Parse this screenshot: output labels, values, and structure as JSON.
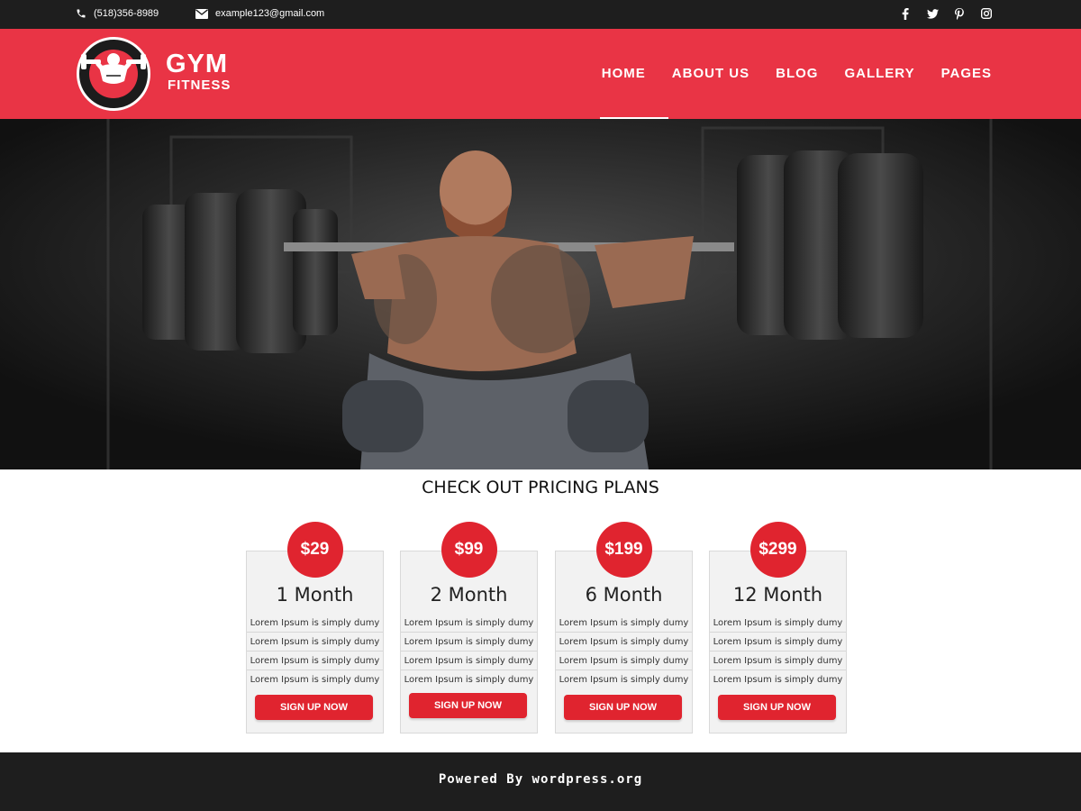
{
  "topbar": {
    "phone": "(518)356-8989",
    "email": "example123@gmail.com",
    "social": [
      "facebook-icon",
      "twitter-icon",
      "pinterest-icon",
      "instagram-icon"
    ]
  },
  "header": {
    "logo_title": "GYM",
    "logo_subtitle": "FITNESS",
    "nav": [
      "HOME",
      "ABOUT US",
      "BLOG",
      "GALLERY",
      "PAGES"
    ],
    "active_nav": "HOME"
  },
  "pricing": {
    "title": "CHECK OUT PRICING PLANS",
    "plans": [
      {
        "price": "$29",
        "duration": "1 Month",
        "features": [
          "Lorem Ipsum is simply dumy",
          "Lorem Ipsum is simply dumy",
          "Lorem Ipsum is simply dumy",
          "Lorem Ipsum is simply dumy"
        ],
        "button": "SIGN UP NOW"
      },
      {
        "price": "$99",
        "duration": "2 Month",
        "features": [
          "Lorem Ipsum is simply dumy",
          "Lorem Ipsum is simply dumy",
          "Lorem Ipsum is simply dumy",
          "Lorem Ipsum is simply dumy"
        ],
        "button": "SIGN UP NOW"
      },
      {
        "price": "$199",
        "duration": "6 Month",
        "features": [
          "Lorem Ipsum is simply dumy",
          "Lorem Ipsum is simply dumy",
          "Lorem Ipsum is simply dumy",
          "Lorem Ipsum is simply dumy"
        ],
        "button": "SIGN UP NOW"
      },
      {
        "price": "$299",
        "duration": "12 Month",
        "features": [
          "Lorem Ipsum is simply dumy",
          "Lorem Ipsum is simply dumy",
          "Lorem Ipsum is simply dumy",
          "Lorem Ipsum is simply dumy"
        ],
        "button": "SIGN UP NOW"
      }
    ]
  },
  "footer": {
    "powered": "Powered By wordpress.org"
  },
  "colors": {
    "brand_red": "#e93445",
    "button_red": "#e0242f",
    "dark": "#1e1e1e"
  }
}
